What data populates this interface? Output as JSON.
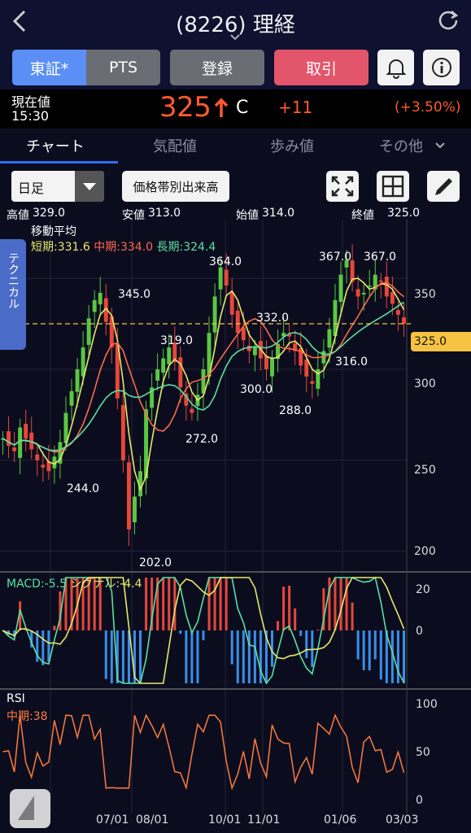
{
  "header": {
    "title": "(8226) 理経"
  },
  "buttons": {
    "tse": "東証*",
    "pts": "PTS",
    "register": "登録",
    "trade": "取引"
  },
  "price": {
    "label": "現在値",
    "time": "15:30",
    "value": "325",
    "flag": "C",
    "change": "+11",
    "change_pct": "(+3.50%)",
    "colors": {
      "up": "#ff5a2d"
    }
  },
  "tabs": [
    {
      "label": "チャート",
      "active": true
    },
    {
      "label": "気配値"
    },
    {
      "label": "歩み値"
    },
    {
      "label": "その他"
    }
  ],
  "toolbar": {
    "period": "日足",
    "volume_button": "価格帯別出来高",
    "icons": [
      "expand-icon",
      "grid-icon",
      "pencil-icon"
    ]
  },
  "ohlc": {
    "high_label": "高値",
    "high": "329.0",
    "low_label": "安値",
    "low": "313.0",
    "open_label": "始値",
    "open": "314.0",
    "close_label": "終値",
    "close": "325.0"
  },
  "technical_tab": "テクニカル",
  "ma": {
    "title": "移動平均",
    "short": "短期:331.6",
    "mid": "中期:334.0",
    "long": "長期:324.4"
  },
  "macd": {
    "label": "MACD:-5.5",
    "signal": "シグナル:-4.4"
  },
  "rsi": {
    "label": "RSI",
    "mid": "中期:38"
  },
  "current_price_tag": "325.0",
  "chart_data": {
    "type": "line",
    "price_axis_ticks": [
      "350",
      "300",
      "250",
      "200"
    ],
    "x_ticks": [
      "07/01",
      "08/01",
      "10/01",
      "11/01",
      "01/06",
      "03/03"
    ],
    "annotations": [
      "345.0",
      "244.0",
      "202.0",
      "319.0",
      "272.0",
      "364.0",
      "332.0",
      "300.0",
      "288.0",
      "367.0",
      "367.0",
      "316.0"
    ],
    "close_series": [
      262,
      258,
      255,
      268,
      262,
      256,
      250,
      246,
      244,
      252,
      260,
      276,
      288,
      300,
      312,
      328,
      338,
      342,
      326,
      312,
      284,
      250,
      212,
      230,
      244,
      278,
      290,
      300,
      306,
      312,
      304,
      290,
      280,
      276,
      286,
      300,
      320,
      340,
      356,
      346,
      330,
      320,
      316,
      310,
      312,
      306,
      300,
      306,
      314,
      320,
      318,
      310,
      302,
      296,
      292,
      300,
      310,
      322,
      338,
      352,
      360,
      348,
      340,
      342,
      346,
      352,
      348,
      340,
      336,
      330,
      325
    ],
    "macd_ticks": [
      "20",
      "0"
    ],
    "rsi_ticks": [
      "100",
      "50",
      "0"
    ],
    "colors": {
      "short": "#e8e86a",
      "mid": "#ff6a4a",
      "long": "#5be0a0",
      "up_candle": "#59c843",
      "down_candle": "#e8473b",
      "macd": "#5be0a0",
      "signal": "#e8e86a",
      "rsi": "#ff7a3c"
    }
  }
}
